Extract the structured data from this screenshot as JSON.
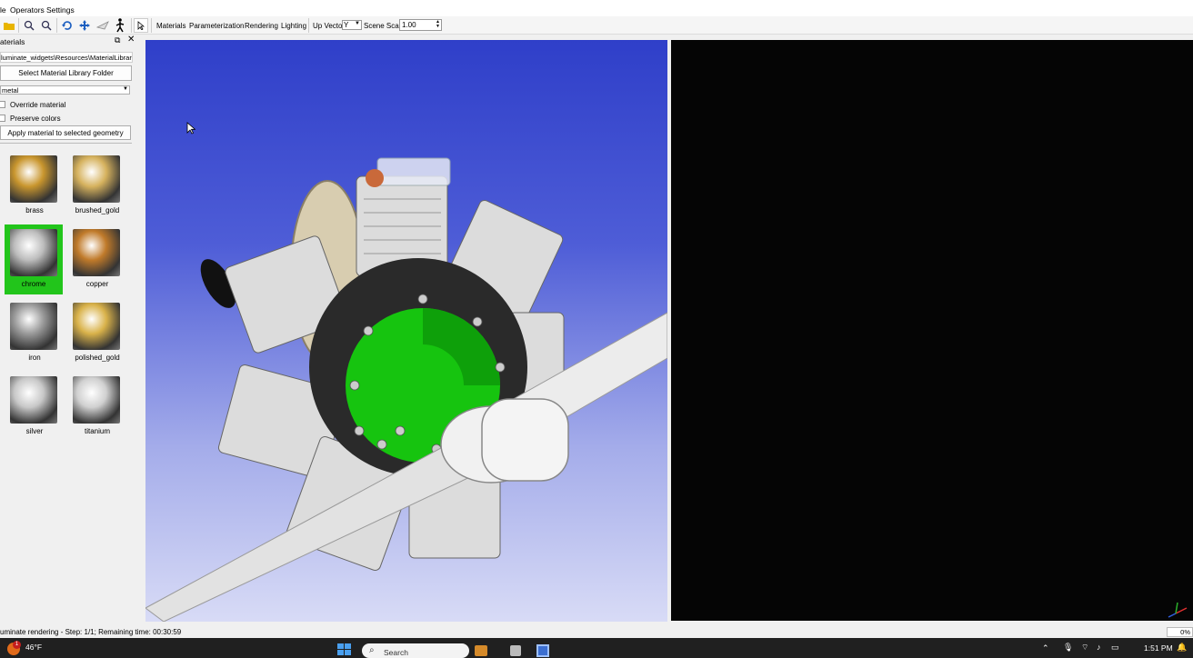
{
  "menubar": {
    "items": [
      "le",
      "Operators",
      "Settings"
    ]
  },
  "toolbar": {
    "tabs": [
      "Materials",
      "Parameterization",
      "Rendering",
      "Lighting"
    ],
    "up_vector_label": "Up Vector",
    "up_vector_value": "Y",
    "scene_scale_label": "Scene Scale",
    "scene_scale_value": "1.00",
    "icons": [
      "open-folder-icon",
      "zoom-in-icon",
      "zoom-out-icon",
      "rotate-icon",
      "pan-icon",
      "fly-icon",
      "walk-icon",
      "select-cursor-icon"
    ]
  },
  "materials_panel": {
    "title": "aterials",
    "path": "luminate_widgets\\Resources\\MaterialLibrary",
    "select_folder_label": "Select Material Library Folder",
    "category_value": "metal",
    "override_label": "Override material",
    "preserve_label": "Preserve colors",
    "apply_label": "Apply material to selected geometry",
    "selected": "chrome",
    "items": [
      {
        "name": "brass",
        "color": "#c9962e"
      },
      {
        "name": "brushed_gold",
        "color": "#d6b25e"
      },
      {
        "name": "chrome",
        "color": "#bdbdbd"
      },
      {
        "name": "copper",
        "color": "#c07a2a"
      },
      {
        "name": "iron",
        "color": "#9a9a9a"
      },
      {
        "name": "polished_gold",
        "color": "#d9b24a"
      },
      {
        "name": "silver",
        "color": "#c8c8c8"
      },
      {
        "name": "titanium",
        "color": "#d0d0d0"
      }
    ],
    "selected_color": "#22c51b"
  },
  "statusbar": {
    "text": "uminate rendering - Step: 1/1; Remaining time: 00:30:59",
    "progress": "0%"
  },
  "taskbar": {
    "weather_temp": "46°F",
    "weather_badge": "1",
    "search_label": "Search",
    "time": "1:51 PM"
  }
}
